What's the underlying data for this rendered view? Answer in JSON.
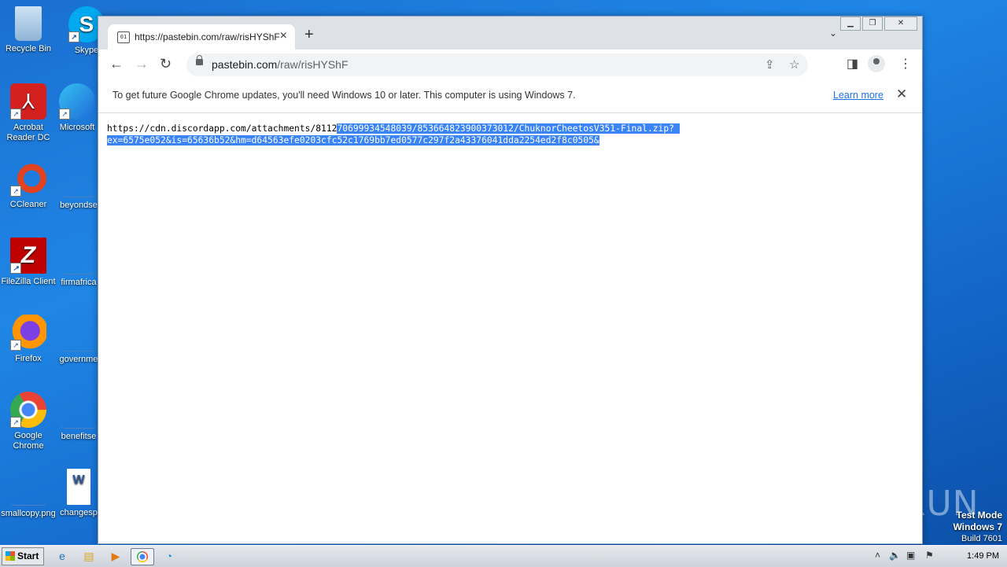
{
  "desktop": {
    "icons": [
      {
        "label": "Recycle Bin"
      },
      {
        "label": "Skype"
      },
      {
        "label": "Acrobat Reader DC"
      },
      {
        "label": "Microsoft"
      },
      {
        "label": "CCleaner"
      },
      {
        "label": "beyondse"
      },
      {
        "label": "FileZilla Client"
      },
      {
        "label": "firmafrica"
      },
      {
        "label": "Firefox"
      },
      {
        "label": "governme"
      },
      {
        "label": "Google Chrome"
      },
      {
        "label": "benefitse"
      },
      {
        "label": "smallcopy.png"
      },
      {
        "label": "changesp"
      }
    ]
  },
  "browser": {
    "tab": {
      "title": "https://pastebin.com/raw/risHYShF",
      "favicon": "raw-page-icon"
    },
    "address": {
      "domain": "pastebin.com",
      "path": "/raw/risHYShF"
    },
    "infobar": {
      "message": "To get future Google Chrome updates, you'll need Windows 10 or later. This computer is using Windows 7.",
      "link": "Learn more"
    },
    "content": {
      "line1_plain": "https://cdn.discordapp.com/attachments/8112",
      "line1_selected": "70699934548039/853664823900373012/ChuknorCheetosV351-Final.zip? ",
      "line2_selected": "ex=6575e052&is=65636b52&hm=d64563efe0203cfc52c1769bb7ed0577c297f2a43376041dda2254ed2f8c0505&"
    }
  },
  "watermark": {
    "text": "ANY RUN"
  },
  "testmode": {
    "line1": "Test Mode",
    "line2": "Windows 7",
    "line3": "Build 7601"
  },
  "taskbar": {
    "start_label": "Start",
    "clock": "1:49 PM"
  },
  "colors": {
    "desktop": "#1f86e6",
    "selection": "#3b84f5",
    "link": "#1a73e8"
  }
}
